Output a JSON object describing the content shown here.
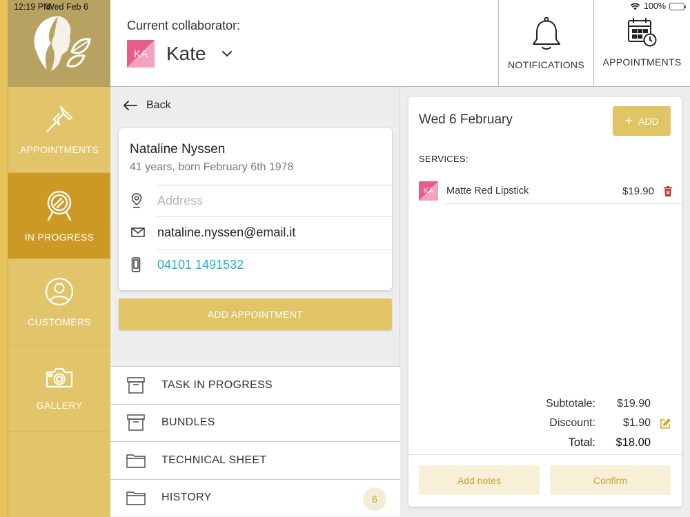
{
  "status_bar": {
    "time": "12:19 PM",
    "date": "Wed Feb 6",
    "battery": "100%"
  },
  "sidebar": {
    "items": [
      {
        "label": "APPOINTMENTS",
        "icon": "pushpin-icon",
        "active": false
      },
      {
        "label": "IN PROGRESS",
        "icon": "mirror-icon",
        "active": true
      },
      {
        "label": "CUSTOMERS",
        "icon": "person-icon",
        "active": false
      },
      {
        "label": "GALLERY",
        "icon": "camera-icon",
        "active": false
      }
    ]
  },
  "header": {
    "collaborator_label": "Current collaborator:",
    "collaborator_initials": "KA",
    "collaborator_name": "Kate",
    "notifications_label": "NOTIFICATIONS",
    "appointments_label": "APPOINTMENTS"
  },
  "customer": {
    "back_label": "Back",
    "name": "Nataline Nyssen",
    "age_line": "41 years, born February 6th 1978",
    "address_placeholder": "Address",
    "email": "nataline.nyssen@email.it",
    "phone": "04101 1491532",
    "add_appointment_label": "ADD APPOINTMENT"
  },
  "menu": [
    {
      "label": "TASK IN PROGRESS",
      "icon": "archive-box-icon"
    },
    {
      "label": "BUNDLES",
      "icon": "archive-box-icon"
    },
    {
      "label": "TECHNICAL SHEET",
      "icon": "folder-icon"
    },
    {
      "label": "HISTORY",
      "icon": "folder-icon",
      "badge": "6"
    }
  ],
  "appointment": {
    "date": "Wed 6 February",
    "add_label": "ADD",
    "services_label": "SERVICES:",
    "services": [
      {
        "initials": "KA",
        "name": "Matte Red Lipstick",
        "price": "$19.90"
      }
    ],
    "subtotal_label": "Subtotale:",
    "subtotal": "$19.90",
    "discount_label": "Discount:",
    "discount": "$1.90",
    "total_label": "Total:",
    "total": "$18.00",
    "notes_label": "Add notes",
    "confirm_label": "Confirm"
  },
  "colors": {
    "gold": "#e0c466",
    "gold_active": "#cc9a24",
    "sidebar": "#e2c46a",
    "logo_bg": "#b8a261",
    "phone": "#21b3c6",
    "avatar_pink": "#e85c8c",
    "delete_red": "#c0392b"
  }
}
